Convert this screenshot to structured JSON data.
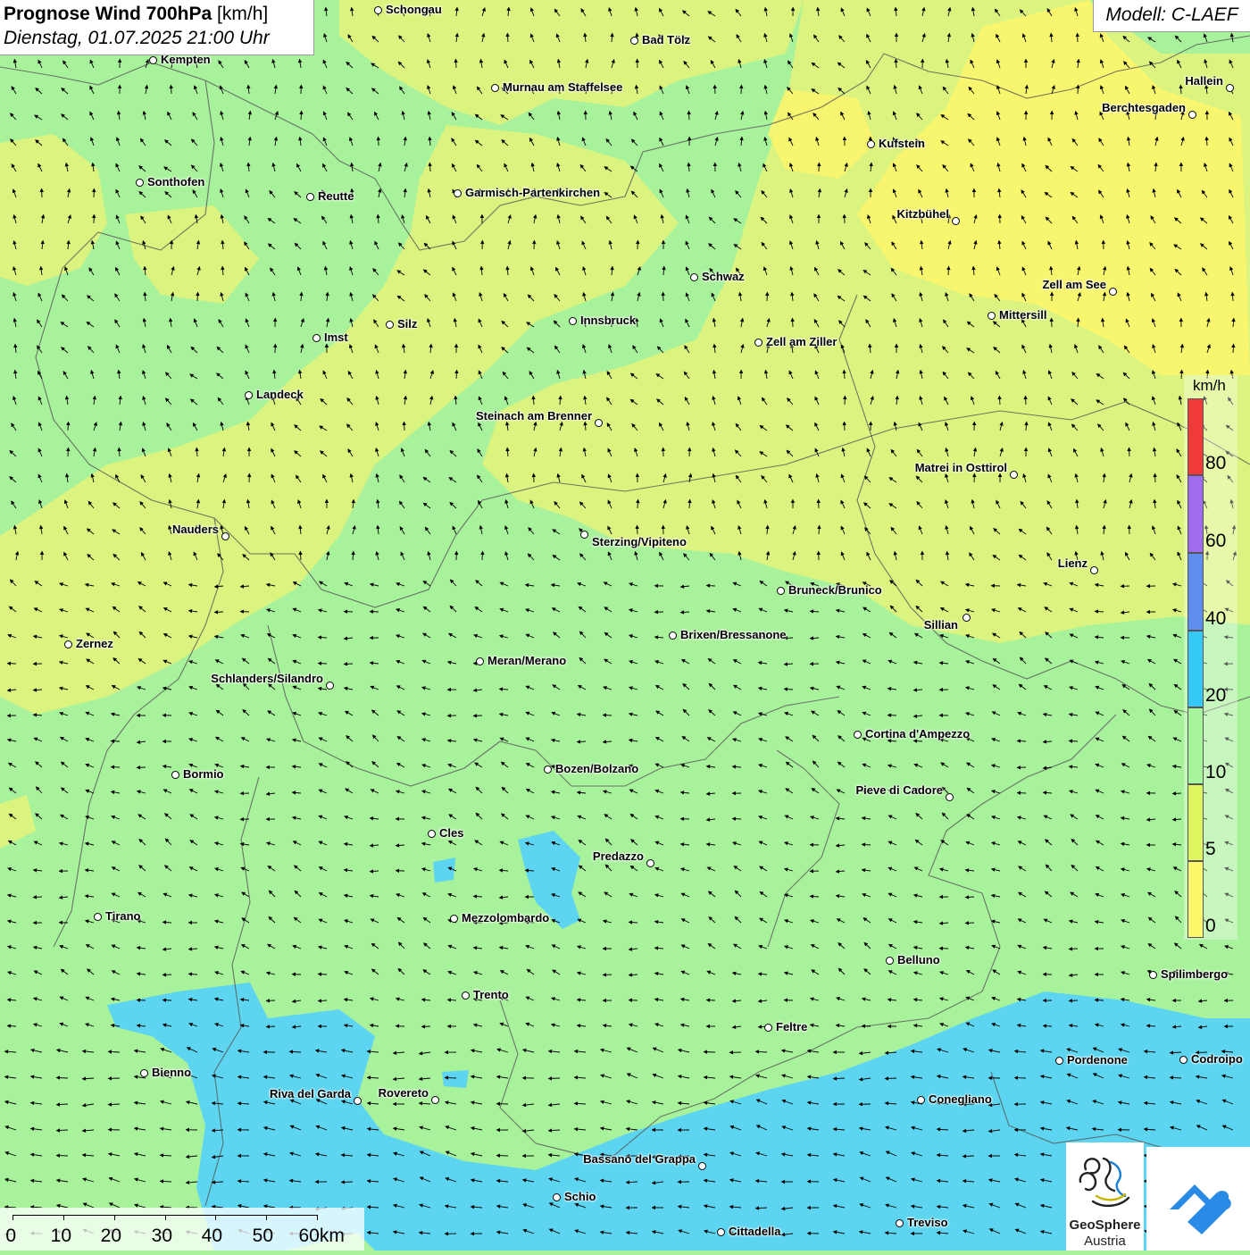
{
  "header": {
    "title_bold": "Prognose Wind 700hPa",
    "title_unit": "[km/h]",
    "subtitle": "Dienstag, 01.07.2025 21:00 Uhr"
  },
  "model": {
    "label": "Modell: C-LAEF"
  },
  "legend": {
    "unit": "km/h",
    "ticks": [
      "80",
      "60",
      "40",
      "20",
      "10",
      "5",
      "0"
    ],
    "bands": [
      {
        "from": 80,
        "color": "#f23a3a"
      },
      {
        "from": 60,
        "color": "#a06cf0"
      },
      {
        "from": 40,
        "color": "#5e8ff0"
      },
      {
        "from": 20,
        "color": "#34c9f7"
      },
      {
        "from": 10,
        "color": "#a6f59c"
      },
      {
        "from": 5,
        "color": "#dff55f"
      },
      {
        "from": 0,
        "color": "#fdf76a"
      }
    ]
  },
  "scale_bar": {
    "labels": [
      "0",
      "10",
      "20",
      "30",
      "40",
      "50",
      "60km"
    ]
  },
  "logos": {
    "geosphere_line1": "GeoSphere",
    "geosphere_line2": "Austria"
  },
  "cities": [
    {
      "name": "Schongau"
    },
    {
      "name": "Bad Tölz"
    },
    {
      "name": "Kempten"
    },
    {
      "name": "Murnau am Staffelsee"
    },
    {
      "name": "Hallein"
    },
    {
      "name": "Berchtesgaden"
    },
    {
      "name": "Kufstein"
    },
    {
      "name": "Sonthofen"
    },
    {
      "name": "Reutte"
    },
    {
      "name": "Garmisch-Partenkirchen"
    },
    {
      "name": "Kitzbühel"
    },
    {
      "name": "Schwaz"
    },
    {
      "name": "Zell am See"
    },
    {
      "name": "Mittersill"
    },
    {
      "name": "Silz"
    },
    {
      "name": "Innsbruck"
    },
    {
      "name": "Imst"
    },
    {
      "name": "Zell am Ziller"
    },
    {
      "name": "Landeck"
    },
    {
      "name": "Steinach am Brenner"
    },
    {
      "name": "Matrei in Osttirol"
    },
    {
      "name": "Nauders"
    },
    {
      "name": "Sterzing/Vipiteno"
    },
    {
      "name": "Lienz"
    },
    {
      "name": "Bruneck/Brunico"
    },
    {
      "name": "Sillian"
    },
    {
      "name": "Zernez"
    },
    {
      "name": "Brixen/Bressanone"
    },
    {
      "name": "Meran/Merano"
    },
    {
      "name": "Schlanders/Silandro"
    },
    {
      "name": "Cortina d'Ampezzo"
    },
    {
      "name": "Bozen/Bolzano"
    },
    {
      "name": "Bormio"
    },
    {
      "name": "Pieve di Cadore"
    },
    {
      "name": "Cles"
    },
    {
      "name": "Predazzo"
    },
    {
      "name": "Tirano"
    },
    {
      "name": "Mezzolombardo"
    },
    {
      "name": "Belluno"
    },
    {
      "name": "Spilimbergo"
    },
    {
      "name": "Trento"
    },
    {
      "name": "Feltre"
    },
    {
      "name": "Pordenone"
    },
    {
      "name": "Codroipo"
    },
    {
      "name": "Bienno"
    },
    {
      "name": "Riva del Garda"
    },
    {
      "name": "Rovereto"
    },
    {
      "name": "Conegliano"
    },
    {
      "name": "Bassano del Grappa"
    },
    {
      "name": "Schio"
    },
    {
      "name": "Treviso"
    },
    {
      "name": "Cittadella"
    }
  ]
}
